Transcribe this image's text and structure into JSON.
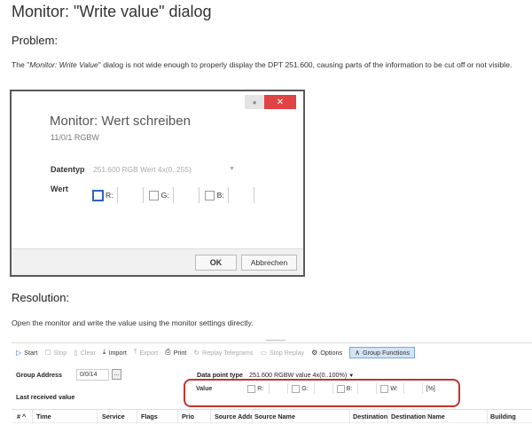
{
  "page": {
    "title": "Monitor: \"Write value\" dialog",
    "problem_heading": "Problem:",
    "problem_text_1": "The \"",
    "problem_text_em": "Monitor: Write Value",
    "problem_text_2": "\" dialog is not wide enough to properly display the DPT 251.600, causing parts of the information to be cut off or not visible.",
    "resolution_heading": "Resolution:",
    "resolution_text": "Open the monitor and write the value using the monitor settings directly."
  },
  "dialog": {
    "minimize_icon": "dot-icon",
    "close_glyph": "✕",
    "title": "Monitor: Wert schreiben",
    "subtitle": "11/0/1 RGBW",
    "datatype_label": "Datentyp",
    "datatype_value": "251.600 RGB Wert 4x(0..255)",
    "value_label": "Wert",
    "channels": [
      "R:",
      "G:",
      "B:"
    ],
    "ok_label": "OK",
    "cancel_label": "Abbrechen"
  },
  "monitor": {
    "toolbar": [
      {
        "icon": "▷",
        "label": "Start",
        "enabled": true
      },
      {
        "icon": "☐",
        "label": "Stop",
        "enabled": false
      },
      {
        "icon": "▯",
        "label": "Clear",
        "enabled": false
      },
      {
        "icon": "⤓",
        "label": "Import",
        "enabled": true
      },
      {
        "icon": "⤒",
        "label": "Export",
        "enabled": false
      },
      {
        "icon": "⎙",
        "label": "Print",
        "enabled": true
      },
      {
        "icon": "↻",
        "label": "Replay Telegrams",
        "enabled": false
      },
      {
        "icon": "▭",
        "label": "Stop Replay",
        "enabled": false
      },
      {
        "icon": "⚙",
        "label": "Options",
        "enabled": true
      },
      {
        "icon": "∧",
        "label": "Group Functions",
        "enabled": true,
        "active": true
      }
    ],
    "group_address_label": "Group Address",
    "group_address_value": "0/0/14",
    "browse_label": "...",
    "dpt_label": "Data point type",
    "dpt_value": "251.600 RGBW value 4x(0..100%)",
    "last_received_label": "Last received value",
    "value_label": "Value",
    "channels": [
      "R:",
      "G:",
      "B:",
      "W:"
    ],
    "unit": "[%]",
    "columns": [
      "# ^",
      "Time",
      "Service",
      "Flags",
      "Prio",
      "Source Addr",
      "Source Name",
      "Destination",
      "Destination Name",
      "Building"
    ]
  }
}
